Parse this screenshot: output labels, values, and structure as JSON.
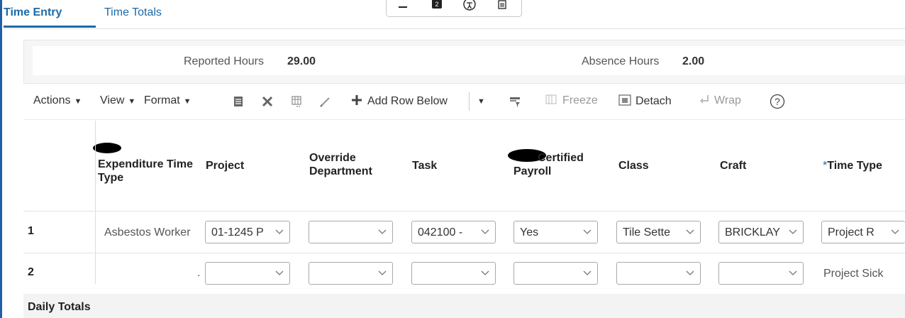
{
  "tabs": [
    {
      "label": "Time Entry",
      "active": true
    },
    {
      "label": "Time Totals",
      "active": false
    }
  ],
  "summary": {
    "reported_label": "Reported Hours",
    "reported_value": "29.00",
    "absence_label": "Absence Hours",
    "absence_value": "2.00"
  },
  "toolbar": {
    "actions": "Actions",
    "view": "View",
    "format": "Format",
    "add_row_below": "Add Row Below",
    "freeze": "Freeze",
    "detach": "Detach",
    "wrap": "Wrap",
    "help": "?"
  },
  "columns": {
    "expenditure": "Expenditure Time Type",
    "project": "Project",
    "override": "Override Department",
    "task": "Task",
    "certified": "Certified Payroll",
    "class": "Class",
    "craft": "Craft",
    "time_type_required": "*",
    "time_type": "Time Type"
  },
  "rows": [
    {
      "num": "1",
      "expenditure": "Asbestos Worker",
      "project": "01-1245 P",
      "override": "",
      "task": "042100 -",
      "certified": "Yes",
      "class": "Tile Sette",
      "craft": "BRICKLAY",
      "time_type": "Project R"
    },
    {
      "num": "2",
      "expenditure": ".",
      "project": "",
      "override": "",
      "task": "",
      "certified": "",
      "class": "",
      "craft": "",
      "time_type": "Project Sick"
    }
  ],
  "daily_totals": "Daily Totals",
  "colors": {
    "accent": "#1b6aa8"
  }
}
